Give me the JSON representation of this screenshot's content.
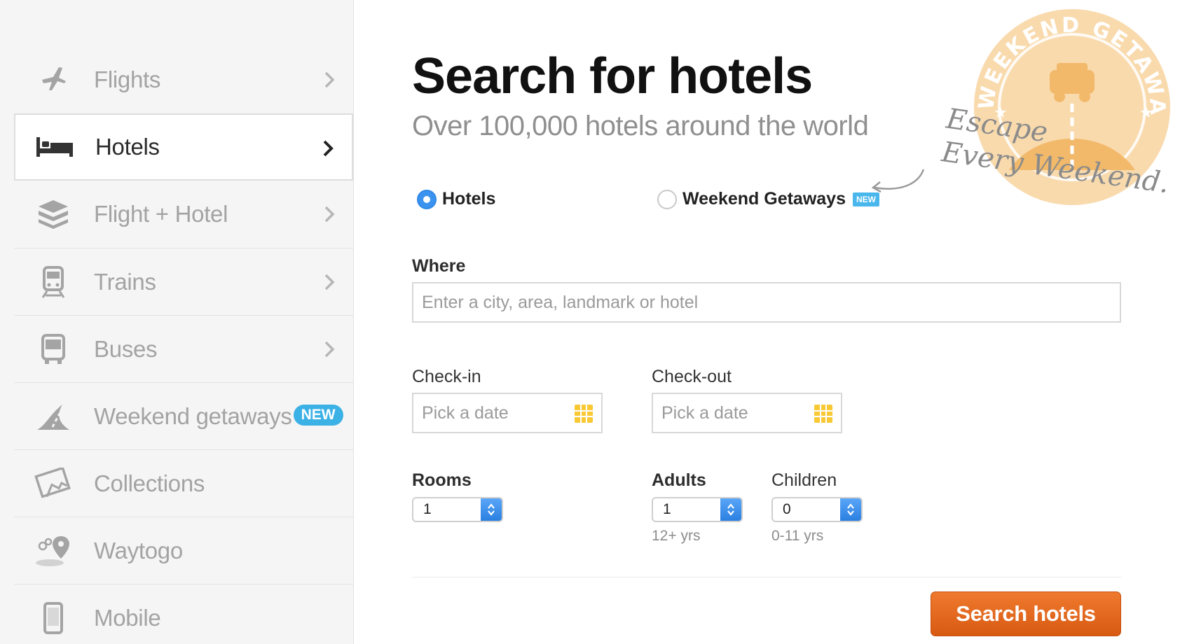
{
  "sidebar": {
    "items": [
      {
        "label": "Flights",
        "icon": "airplane-icon",
        "active": false,
        "chevron": true
      },
      {
        "label": "Hotels",
        "icon": "bed-icon",
        "active": true,
        "chevron": true
      },
      {
        "label": "Flight + Hotel",
        "icon": "package-icon",
        "active": false,
        "chevron": true
      },
      {
        "label": "Trains",
        "icon": "train-icon",
        "active": false,
        "chevron": true
      },
      {
        "label": "Buses",
        "icon": "bus-icon",
        "active": false,
        "chevron": true
      },
      {
        "label": "Weekend getaways",
        "icon": "road-icon",
        "active": false,
        "chevron": false,
        "badge": "NEW"
      },
      {
        "label": "Collections",
        "icon": "photos-icon",
        "active": false,
        "chevron": false
      },
      {
        "label": "Waytogo",
        "icon": "map-pin-icon",
        "active": false,
        "chevron": false
      },
      {
        "label": "Mobile",
        "icon": "phone-icon",
        "active": false,
        "chevron": false
      }
    ]
  },
  "main": {
    "title": "Search for hotels",
    "subtitle": "Over 100,000 hotels around the world",
    "radio": {
      "hotels": "Hotels",
      "weekend": "Weekend Getaways",
      "weekend_tag": "NEW",
      "selected": "hotels"
    },
    "where": {
      "label": "Where",
      "placeholder": "Enter a city, area, landmark or hotel"
    },
    "checkin": {
      "label": "Check-in",
      "placeholder": "Pick a date"
    },
    "checkout": {
      "label": "Check-out",
      "placeholder": "Pick a date"
    },
    "rooms": {
      "label": "Rooms",
      "value": "1"
    },
    "adults": {
      "label": "Adults",
      "value": "1",
      "hint": "12+ yrs"
    },
    "children": {
      "label": "Children",
      "value": "0",
      "hint": "0-11 yrs"
    },
    "search_button": "Search hotels"
  },
  "promo": {
    "stamp_text": "WEEKEND GETAWAYS",
    "script_line1": "Escape",
    "script_line2": "Every Weekend."
  },
  "colors": {
    "accent_blue": "#3b93ef",
    "new_badge": "#3cb1e6",
    "search_orange": "#e2661d",
    "stamp_orange": "#f6c98a"
  }
}
